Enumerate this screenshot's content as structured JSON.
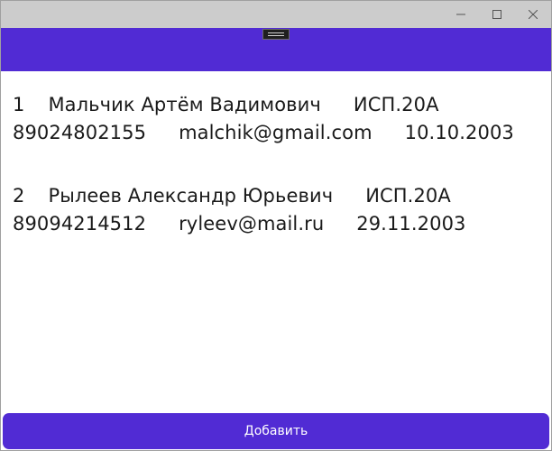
{
  "window": {
    "controls": {
      "minimize_icon": "minimize-icon",
      "maximize_icon": "maximize-icon",
      "close_icon": "close-icon"
    }
  },
  "colors": {
    "titlebar": "#cccccc",
    "accent": "#512bd4",
    "button_text": "#ffffff",
    "text": "#1a1a1a"
  },
  "students": [
    {
      "number": "1",
      "full_name": "Мальчик Артём Вадимович",
      "group": "ИСП.20А",
      "phone": "89024802155",
      "email": "malchik@gmail.com",
      "birth_date": "10.10.2003"
    },
    {
      "number": "2",
      "full_name": "Рылеев Александр Юрьевич",
      "group": "ИСП.20А",
      "phone": "89094214512",
      "email": "ryleev@mail.ru",
      "birth_date": "29.11.2003"
    }
  ],
  "actions": {
    "add_label": "Добавить"
  }
}
